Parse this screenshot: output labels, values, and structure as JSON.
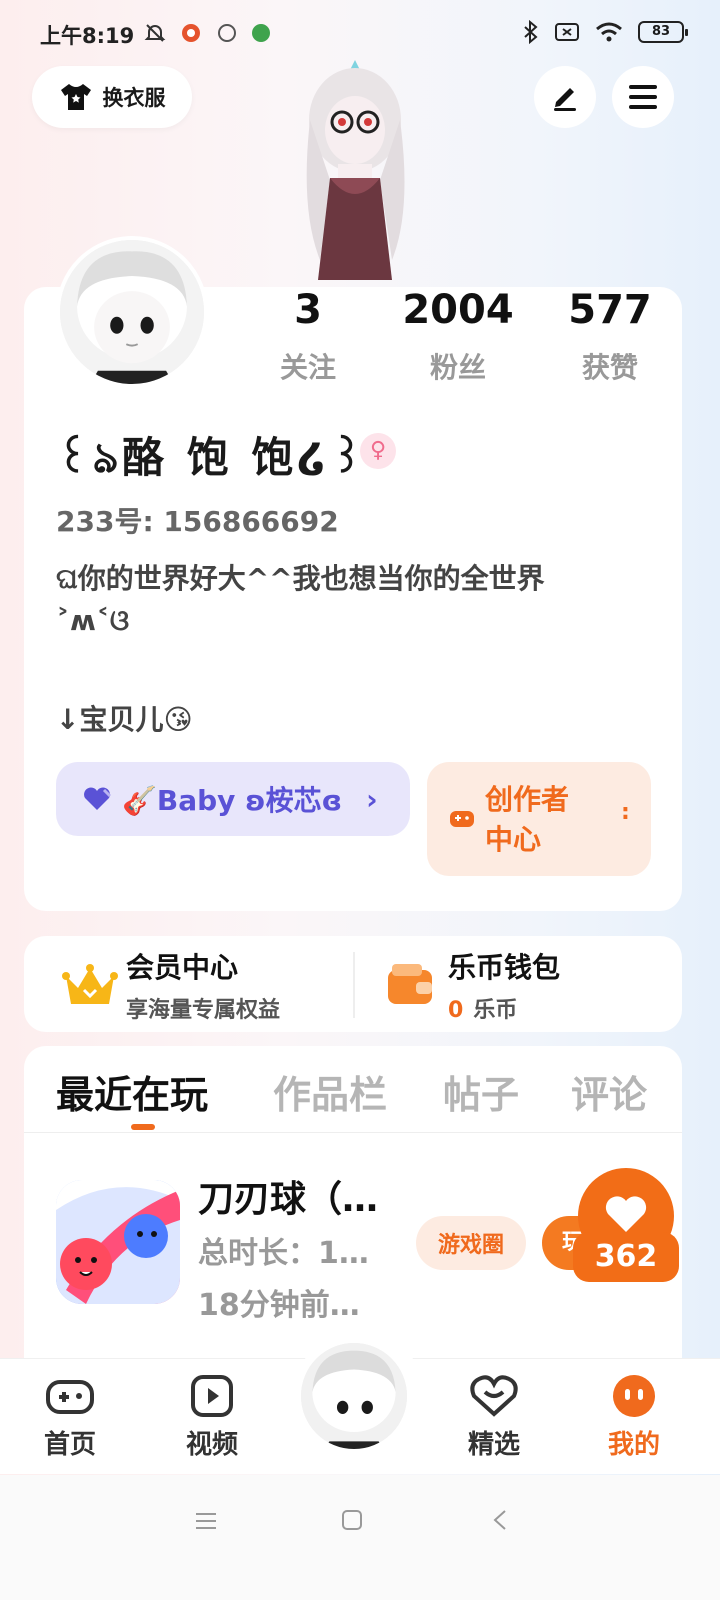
{
  "status_bar": {
    "time": "上午8:19",
    "battery": "83"
  },
  "top": {
    "dress_label": "换衣服"
  },
  "profile": {
    "username": "꒰ঌ酪 饱 饱໒꒱",
    "gender_symbol": "♀",
    "uid": "233号: 156866692",
    "bio_line1": "ଘ你的世界好大^^我也想当你的全世界",
    "bio_line2": "˃ʍ˂ଓ",
    "bio_line3": "↓宝贝儿😘",
    "stats": [
      {
        "value": "3",
        "label": "关注"
      },
      {
        "value": "2004",
        "label": "粉丝"
      },
      {
        "value": "577",
        "label": "获赞"
      }
    ],
    "fan_chip": "🎸Baby ʚ桉芯ɞ",
    "creator_line1": "创作者",
    "creator_line2": "中心"
  },
  "member": {
    "title": "会员中心",
    "subtitle": "享海量专属权益"
  },
  "wallet": {
    "title": "乐币钱包",
    "amount": "0",
    "unit": "乐币"
  },
  "tabs": [
    "最近在玩",
    "作品栏",
    "帖子",
    "评论"
  ],
  "recent_game": {
    "title": "刀刃球（…",
    "duration": "总时长：1…",
    "last_played": "18分钟前…",
    "circle_label": "游戏圈",
    "play_label": "玩",
    "likes": "362"
  },
  "bottom_nav": [
    {
      "label": "首页",
      "icon": "gamepad-icon"
    },
    {
      "label": "视频",
      "icon": "play-icon"
    },
    {
      "label": "精选",
      "icon": "heart-chat-icon"
    },
    {
      "label": "我的",
      "icon": "smile-icon"
    }
  ],
  "colors": {
    "accent": "#f06a1d",
    "fan_chip_bg": "#e8e6fb",
    "fan_chip_text": "#5a52d6",
    "creator_bg": "#fdebe1"
  }
}
